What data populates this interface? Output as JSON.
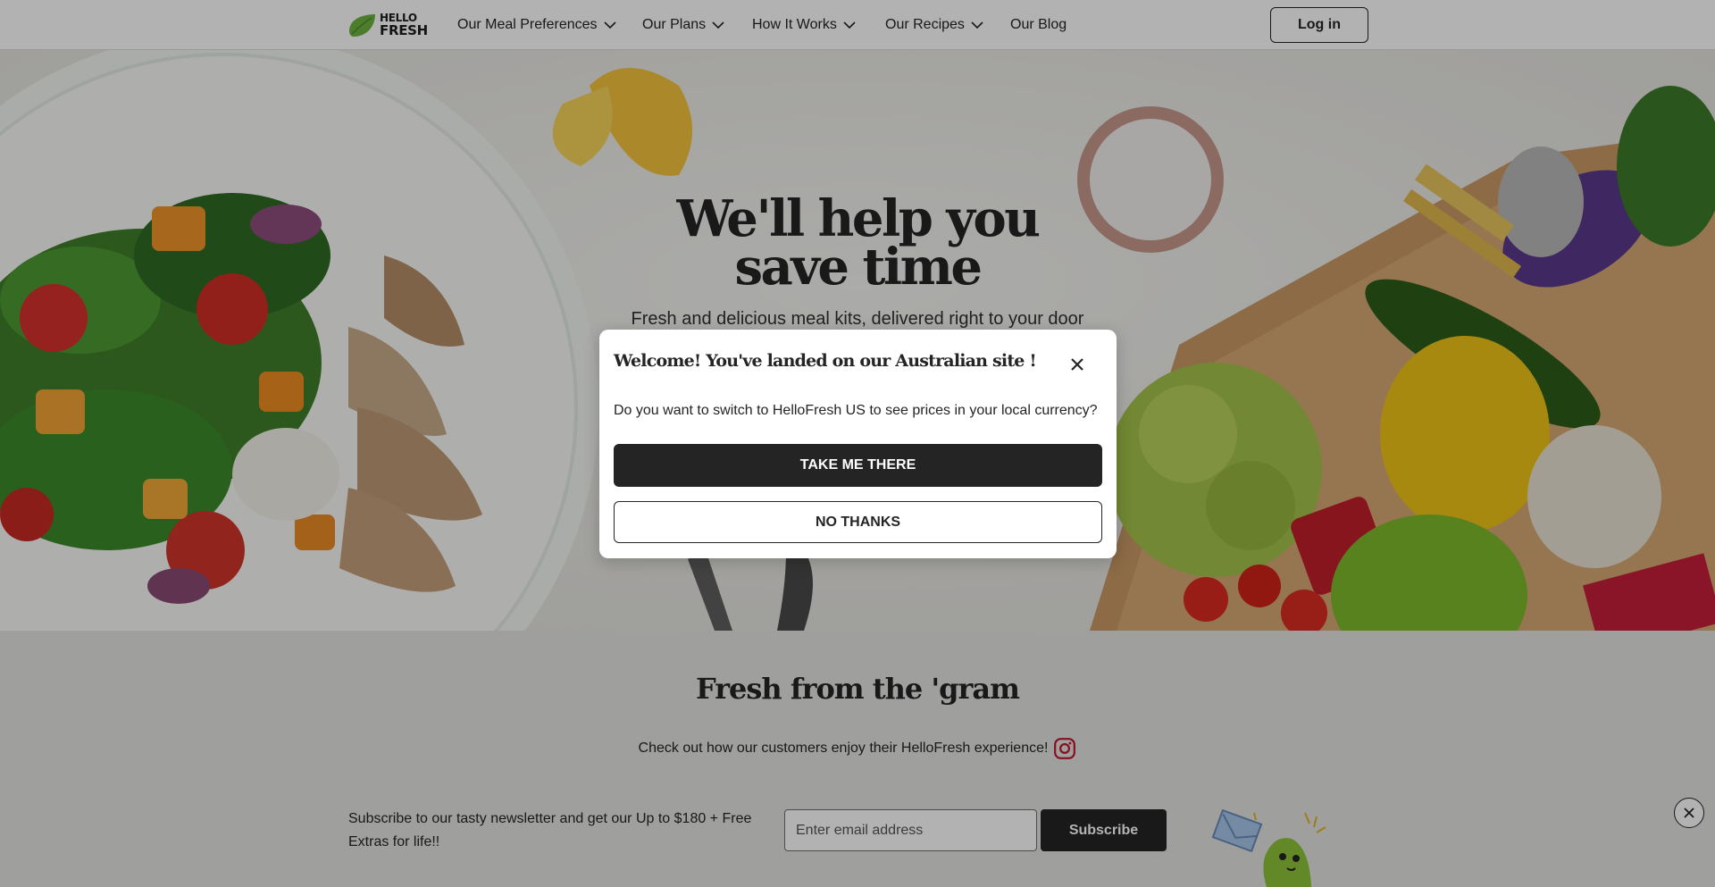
{
  "header": {
    "logo_text_line1": "HELLO",
    "logo_text_line2": "FRESH",
    "nav": [
      {
        "label": "Our Meal Preferences",
        "has_chevron": true
      },
      {
        "label": "Our Plans",
        "has_chevron": true
      },
      {
        "label": "How It Works",
        "has_chevron": true
      },
      {
        "label": "Our Recipes",
        "has_chevron": true
      },
      {
        "label": "Our Blog",
        "has_chevron": false
      }
    ],
    "login_label": "Log in"
  },
  "hero": {
    "title_line1": "We'll help you",
    "title_line2": "save time",
    "subtitle": "Fresh and delicious meal kits, delivered right to your door"
  },
  "gram": {
    "title": "Fresh from the 'gram",
    "subtitle": "Check out how our customers enjoy their HelloFresh experience!",
    "icon": "instagram-icon"
  },
  "newsletter": {
    "text": "Subscribe to our tasty newsletter and get our Up to $180 + Free Extras for life!!",
    "email_placeholder": "Enter email address",
    "subscribe_label": "Subscribe"
  },
  "modal": {
    "title": "Welcome! You've landed on our Australian site !",
    "text": "Do you want to switch to HelloFresh US to see prices in your local currency?",
    "primary_label": "TAKE ME THERE",
    "secondary_label": "NO THANKS"
  },
  "colors": {
    "brand_green": "#6cb33f",
    "instagram_red": "#c3132a",
    "dark": "#242424"
  }
}
